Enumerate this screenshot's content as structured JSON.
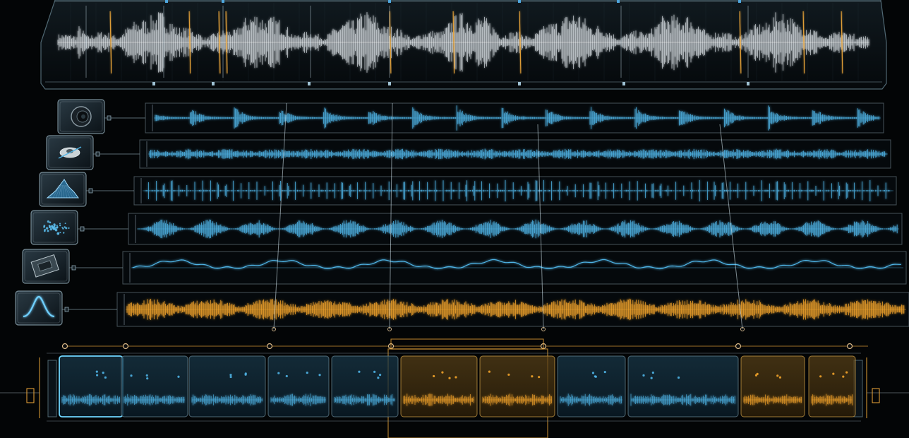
{
  "theme": {
    "background": "#030506",
    "panel_edge": "#6f8e9c",
    "waveform_master": "#e8eef2",
    "waveform_cyan": "#4fb4e6",
    "waveform_amber": "#f2a32a",
    "marker_amber": "#f0a93a",
    "marker_blue": "#4fa8e0",
    "segment_fill_blue": "#0e2a3a",
    "segment_fill_amber": "#3a2a10"
  },
  "master_track": {
    "color_markers": [
      "amber",
      "blue"
    ]
  },
  "tracks": [
    {
      "icon": "speaker-icon",
      "waveform": "transient",
      "color": "cyan"
    },
    {
      "icon": "turbine-icon",
      "waveform": "dense",
      "color": "cyan"
    },
    {
      "icon": "spectral-peak-icon",
      "waveform": "pulse",
      "color": "cyan"
    },
    {
      "icon": "particle-cloud-icon",
      "waveform": "modulated",
      "color": "cyan"
    },
    {
      "icon": "circuit-module-icon",
      "waveform": "smooth",
      "color": "cyan"
    },
    {
      "icon": "bell-curve-icon",
      "waveform": "grain",
      "color": "amber"
    }
  ],
  "segments": [
    {
      "color": "blue",
      "highlight": true
    },
    {
      "color": "blue",
      "highlight": false
    },
    {
      "color": "blue",
      "highlight": false
    },
    {
      "color": "blue",
      "highlight": false
    },
    {
      "color": "blue",
      "highlight": false
    },
    {
      "color": "amber",
      "highlight": false
    },
    {
      "color": "amber",
      "highlight": false
    },
    {
      "color": "blue",
      "highlight": false
    },
    {
      "color": "blue",
      "highlight": false
    },
    {
      "color": "amber",
      "highlight": false
    },
    {
      "color": "amber",
      "highlight": false
    }
  ]
}
